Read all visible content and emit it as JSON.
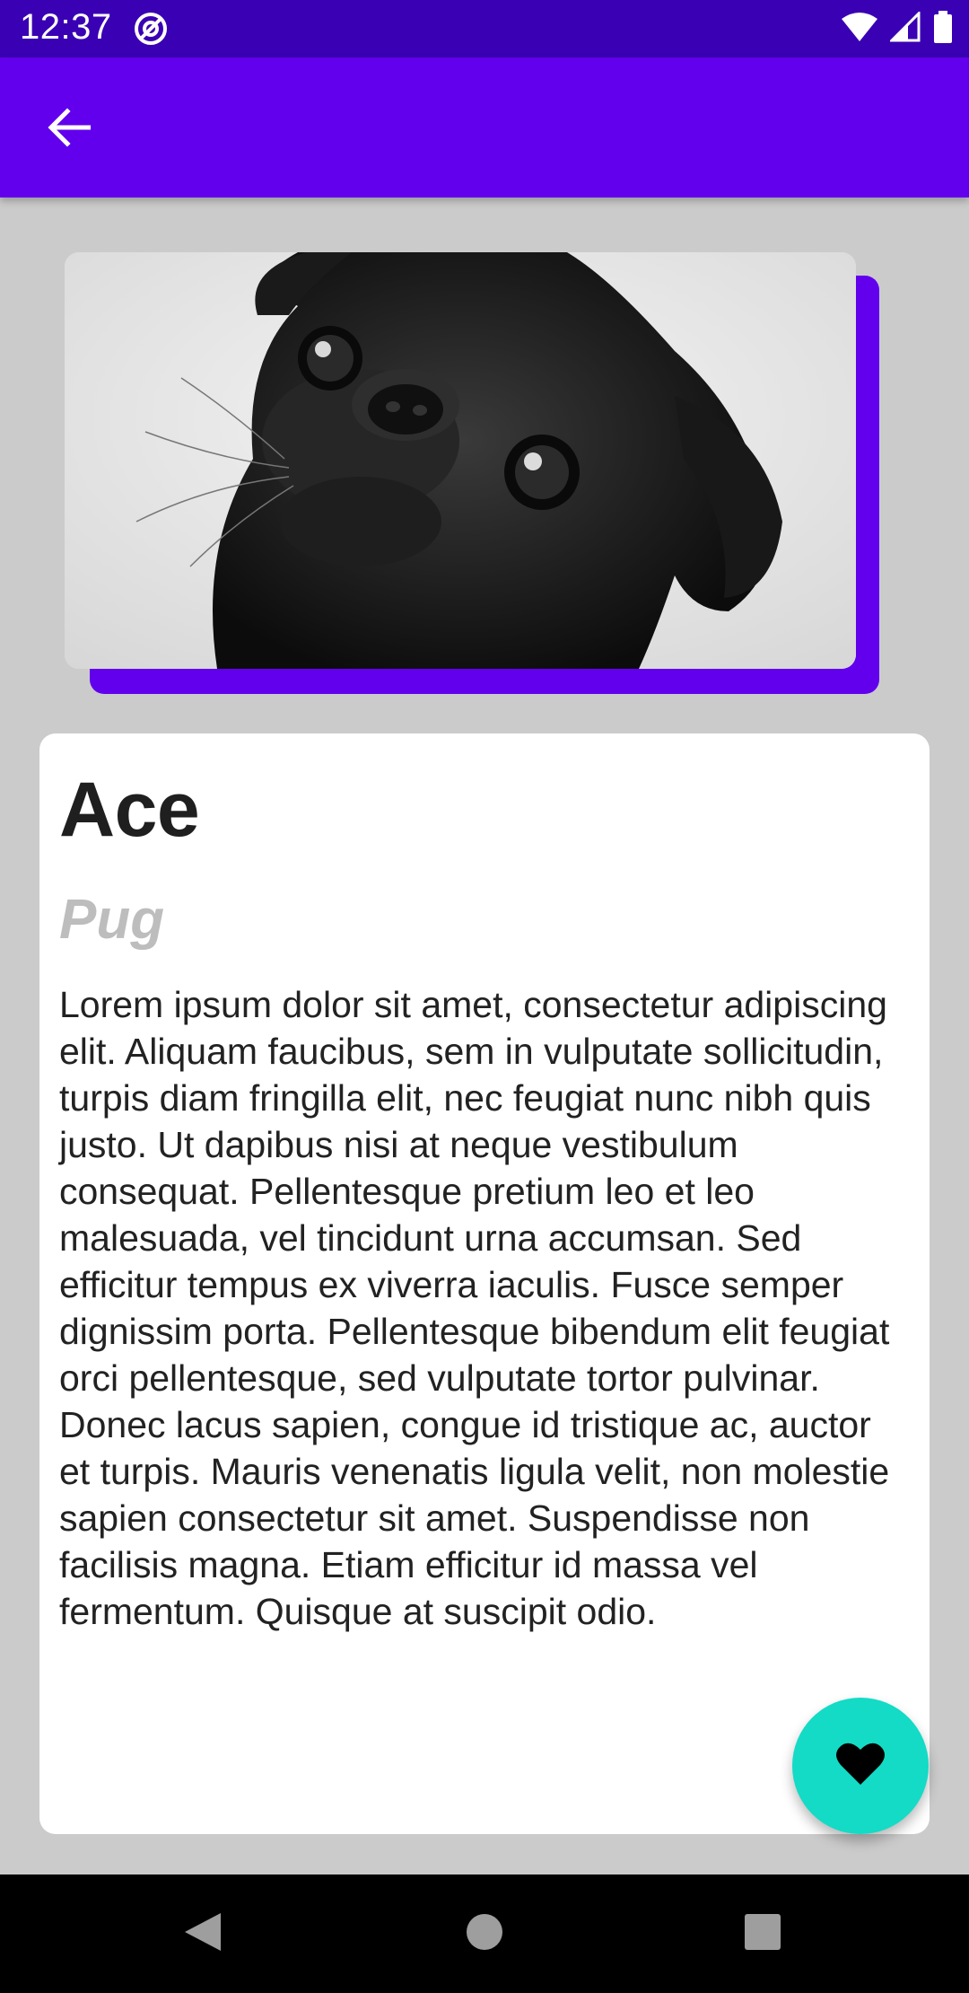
{
  "status_bar": {
    "time": "12:37",
    "icons": [
      "at-icon",
      "wifi-icon",
      "signal-icon",
      "battery-icon"
    ]
  },
  "app_bar": {
    "back_icon": "arrow-back-icon",
    "color": "#6200ee"
  },
  "pet": {
    "name": "Ace",
    "breed": "Pug",
    "description": "Lorem ipsum dolor sit amet, consectetur adipiscing elit. Aliquam faucibus, sem in vulputate sollicitudin, turpis diam fringilla elit, nec feugiat nunc nibh quis justo. Ut dapibus nisi at neque vestibulum consequat. Pellentesque pretium leo et leo malesuada, vel tincidunt urna accumsan. Sed efficitur tempus ex viverra iaculis. Fusce semper dignissim porta. Pellentesque bibendum elit feugiat orci pellentesque, sed vulputate tortor pulvinar. Donec lacus sapien, congue id tristique ac, auctor et turpis. Mauris venenatis ligula velit, non molestie sapien consectetur sit amet. Suspendisse non facilisis magna. Etiam efficitur id massa vel fermentum. Quisque at suscipit odio.",
    "image": "pug-photo"
  },
  "fab": {
    "icon": "heart-icon",
    "color": "#13dbc6"
  },
  "nav_bar": {
    "icons": [
      "nav-back-icon",
      "nav-home-icon",
      "nav-recents-icon"
    ]
  },
  "colors": {
    "primary": "#6200ee",
    "status_bar": "#3a00b3",
    "accent": "#13dbc6",
    "background": "#cbcbcb"
  }
}
